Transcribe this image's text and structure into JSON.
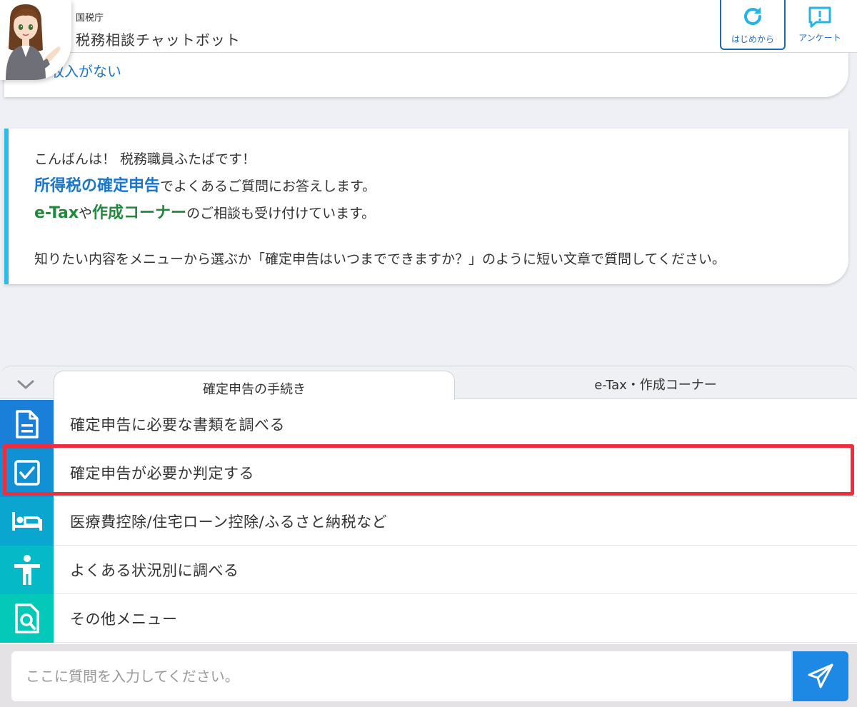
{
  "header": {
    "agency": "国税庁",
    "title": "税務相談チャットボット",
    "restart_label": "はじめから",
    "survey_label": "アンケート"
  },
  "chat": {
    "previous_option": "収入がない",
    "greeting": {
      "line1": "こんばんは！ 税務職員ふたばです！",
      "line2_highlight": "所得税の確定申告",
      "line2_rest": "でよくあるご質問にお答えします。",
      "line3_etax": "e-Tax",
      "line3_mid": "や",
      "line3_corner": "作成コーナー",
      "line3_rest": "のご相談も受け付けています。",
      "line4": "知りたい内容をメニューから選ぶか「確定申告はいつまでできますか？」のように短い文章で質問してください。"
    }
  },
  "menu": {
    "tabs": [
      {
        "label": "確定申告の手続き",
        "active": true
      },
      {
        "label": "e-Tax・作成コーナー",
        "active": false
      }
    ],
    "items": [
      {
        "label": "確定申告に必要な書類を調べる",
        "icon": "document-icon",
        "color": "#1a7fd9"
      },
      {
        "label": "確定申告が必要か判定する",
        "icon": "checkbox-icon",
        "color": "#1191d4"
      },
      {
        "label": "医療費控除/住宅ローン控除/ふるさと納税など",
        "icon": "bed-icon",
        "color": "#0ba6cf"
      },
      {
        "label": "よくある状況別に調べる",
        "icon": "person-icon",
        "color": "#05b9c6"
      },
      {
        "label": "その他メニュー",
        "icon": "search-document-icon",
        "color": "#04c9b8"
      }
    ]
  },
  "input": {
    "placeholder": "ここに質問を入力してください。"
  },
  "colors": {
    "accent": "#1e88e5",
    "highlight": "#ee2e3c",
    "link": "#1a76c9",
    "green": "#1f8a3c"
  }
}
